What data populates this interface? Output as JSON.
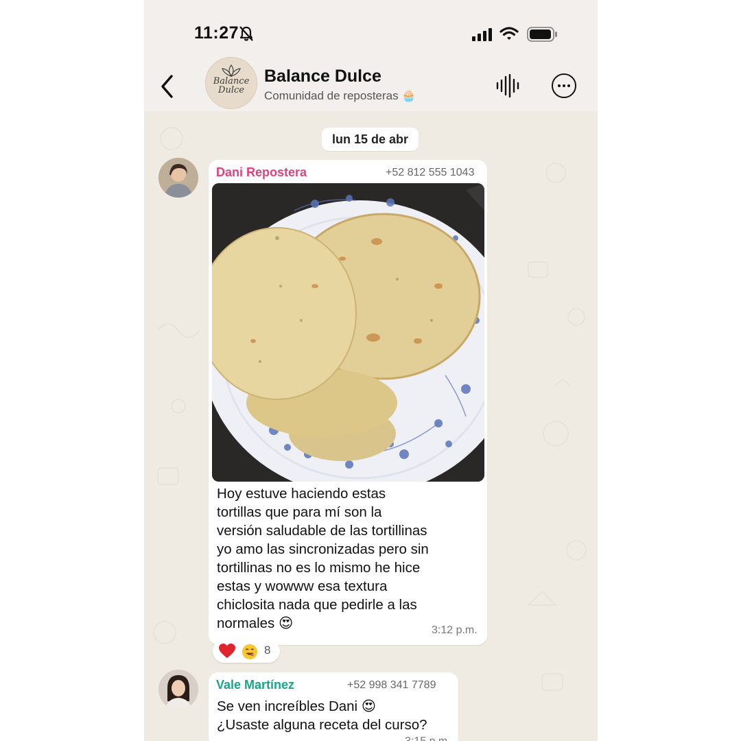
{
  "status": {
    "time": "11:27"
  },
  "header": {
    "title": "Balance Dulce",
    "subtitle": "Comunidad de reposteras 🧁",
    "logo_line1": "Balance",
    "logo_line2": "Dulce"
  },
  "date_chip": "lun 15 de abr",
  "messages": [
    {
      "sender": "Dani Repostera",
      "phone": "+52 812 555 1043",
      "lines": [
        "Hoy estuve haciendo estas",
        "tortillas que para mí son la",
        "versión saludable de las tortillinas",
        "yo amo las sincronizadas pero sin",
        "tortillinas no es lo mismo he hice",
        "estas y wowww esa textura",
        "chiclosita nada que pedirle a las",
        "normales 😍"
      ],
      "time": "3:12 p.m.",
      "reaction_count": "8"
    },
    {
      "sender": "Vale Martínez",
      "phone": "+52 998 341 7789",
      "lines": [
        "Se ven increíbles Dani 😍",
        "¿Usaste alguna receta del curso?"
      ],
      "time": "3:15 p.m."
    }
  ],
  "colors": {
    "background": "#efeae2",
    "pink": "#e5407d",
    "teal": "#19a58a"
  },
  "icons": [
    "bell-off-icon",
    "signal-icon",
    "wifi-icon",
    "battery-icon",
    "back-icon",
    "voice-icon",
    "more-icon",
    "heart-icon",
    "smile-icon"
  ]
}
